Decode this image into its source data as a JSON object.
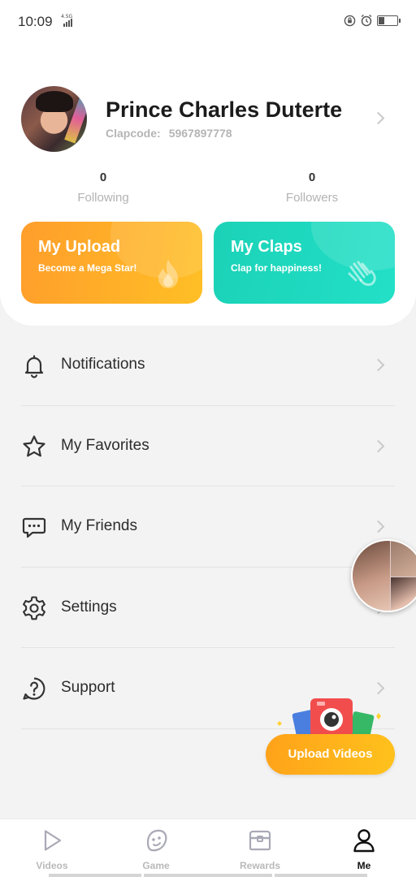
{
  "status_bar": {
    "time": "10:09",
    "network": "4.5G",
    "battery_level": 0.3
  },
  "profile": {
    "name": "Prince Charles Duterte",
    "clapcode_label": "Clapcode:",
    "clapcode_value": "5967897778",
    "following_count": "0",
    "following_label": "Following",
    "followers_count": "0",
    "followers_label": "Followers"
  },
  "promos": {
    "upload": {
      "title": "My Upload",
      "subtitle": "Become a Mega Star!",
      "icon": "flame-icon",
      "color": "#ffa92a"
    },
    "claps": {
      "title": "My Claps",
      "subtitle": "Clap for happiness!",
      "icon": "clapping-hands-icon",
      "color": "#1fd8be"
    }
  },
  "menu": {
    "items": [
      {
        "label": "Notifications",
        "icon": "bell-icon"
      },
      {
        "label": "My Favorites",
        "icon": "star-icon"
      },
      {
        "label": "My Friends",
        "icon": "chat-bubble-icon"
      },
      {
        "label": "Settings",
        "icon": "gear-icon"
      },
      {
        "label": "Support",
        "icon": "question-icon"
      }
    ]
  },
  "upload_button": {
    "label": "Upload Videos"
  },
  "bottom_nav": {
    "items": [
      {
        "label": "Videos",
        "icon": "play-icon"
      },
      {
        "label": "Game",
        "icon": "game-icon"
      },
      {
        "label": "Rewards",
        "icon": "treasure-chest-icon"
      },
      {
        "label": "Me",
        "icon": "person-icon"
      }
    ],
    "active": "Me"
  },
  "colors": {
    "accent_orange": "#ffa92a",
    "accent_teal": "#1fd8be",
    "text_dark": "#1b1b1b"
  }
}
